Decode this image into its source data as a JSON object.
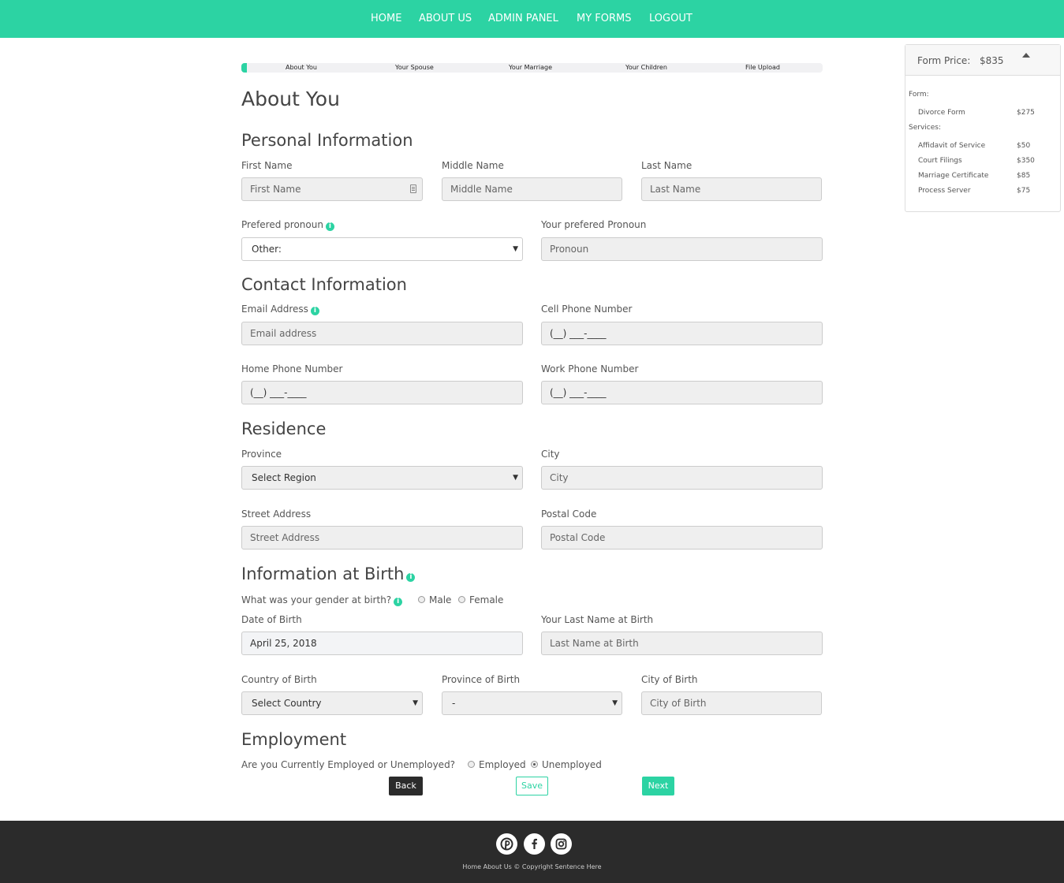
{
  "nav": {
    "home": "HOME",
    "about": "ABOUT US",
    "admin": "ADMIN PANEL",
    "forms": "MY FORMS",
    "logout": "LOGOUT"
  },
  "progress": {
    "fraction": 0.01,
    "steps": [
      "About You",
      "Your Spouse",
      "Your Marriage",
      "Your Children",
      "File Upload"
    ]
  },
  "page_title": "About You",
  "personal": {
    "heading": "Personal Information",
    "first_name": {
      "label": "First Name",
      "placeholder": "First Name"
    },
    "middle_name": {
      "label": "Middle Name",
      "placeholder": "Middle Name"
    },
    "last_name": {
      "label": "Last Name",
      "placeholder": "Last Name"
    },
    "pronoun": {
      "label": "Prefered pronoun",
      "value": "Other:"
    },
    "custom_pronoun": {
      "label": "Your prefered Pronoun",
      "placeholder": "Pronoun"
    }
  },
  "contact": {
    "heading": "Contact Information",
    "email": {
      "label": "Email Address",
      "placeholder": "Email address"
    },
    "cell": {
      "label": "Cell Phone Number",
      "placeholder": "(__) ___-____"
    },
    "home": {
      "label": "Home Phone Number",
      "placeholder": "(__) ___-____"
    },
    "work": {
      "label": "Work Phone Number",
      "placeholder": "(__) ___-____"
    }
  },
  "residence": {
    "heading": "Residence",
    "province": {
      "label": "Province",
      "value": "Select Region"
    },
    "city": {
      "label": "City",
      "placeholder": "City"
    },
    "street": {
      "label": "Street Address",
      "placeholder": "Street Address"
    },
    "postal": {
      "label": "Postal Code",
      "placeholder": "Postal Code"
    }
  },
  "birth": {
    "heading": "Information at Birth",
    "gender_question": "What was your gender at birth?",
    "gender_options": [
      "Male",
      "Female"
    ],
    "dob": {
      "label": "Date of Birth",
      "value": "April 25, 2018"
    },
    "last_name": {
      "label": "Your Last Name at Birth",
      "placeholder": "Last Name at Birth"
    },
    "country": {
      "label": "Country of Birth",
      "value": "Select Country"
    },
    "province": {
      "label": "Province of Birth",
      "value": "-"
    },
    "city": {
      "label": "City of Birth",
      "placeholder": "City of Birth"
    }
  },
  "employment": {
    "heading": "Employment",
    "question": "Are you Currently Employed or Unemployed?",
    "options": [
      "Employed",
      "Unemployed"
    ],
    "selected": "Unemployed"
  },
  "buttons": {
    "back": "Back",
    "save": "Save",
    "next": "Next"
  },
  "price_panel": {
    "title": "Form Price:",
    "total": "$835",
    "form_label": "Form:",
    "form_items": [
      {
        "name": "Divorce Form",
        "price": "$275"
      }
    ],
    "services_label": "Services:",
    "services": [
      {
        "name": "Affidavit of Service",
        "price": "$50"
      },
      {
        "name": "Court Filings",
        "price": "$350"
      },
      {
        "name": "Marriage Certificate",
        "price": "$85"
      },
      {
        "name": "Process Server",
        "price": "$75"
      }
    ]
  },
  "footer": {
    "social_icons": [
      "pinterest-icon",
      "facebook-icon",
      "instagram-icon"
    ],
    "links_text": "Home  About Us  © Copyright Sentence Here"
  },
  "colors": {
    "accent": "#2cd3a3",
    "dark": "#2b2b2b"
  }
}
